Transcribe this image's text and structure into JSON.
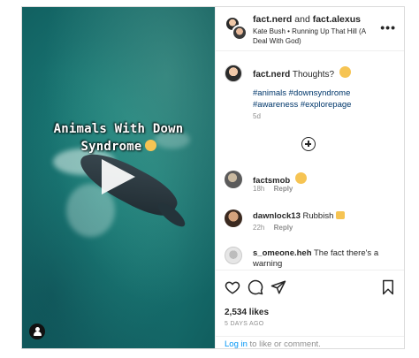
{
  "post": {
    "video": {
      "overlay_line1": "Animals With Down",
      "overlay_line2": "Syndrome",
      "overlay_emoji": "flushed-face"
    },
    "header": {
      "user1": "fact.nerd",
      "joiner": " and ",
      "user2": "fact.alexus",
      "audio": "Kate Bush • Running Up That Hill (A Deal With God)",
      "more": "•••"
    },
    "caption": {
      "username": "fact.nerd",
      "text": "Thoughts?",
      "emoji": "thinking-face",
      "hashtags": "#animals #downsyndrome #awareness #explorepage",
      "time": "5d"
    },
    "comments": [
      {
        "username": "factsmob",
        "text": "",
        "emoji": "surprised-face",
        "time": "18h",
        "reply": "Reply"
      },
      {
        "username": "dawnlock13",
        "text": "Rubbish",
        "emoji": "thumbs-down",
        "time": "22h",
        "reply": "Reply"
      },
      {
        "username": "s_omeone.heh",
        "text": "The fact there's a warning",
        "emoji": "",
        "time": "",
        "reply": ""
      }
    ],
    "likes": "2,534 likes",
    "date": "5 DAYS AGO",
    "login": {
      "link": "Log in",
      "rest": " to like or comment."
    }
  },
  "colors": {
    "link": "#0095f6",
    "hashtag": "#00376b",
    "muted": "#8e8e8e",
    "water": "#1b7d78"
  }
}
